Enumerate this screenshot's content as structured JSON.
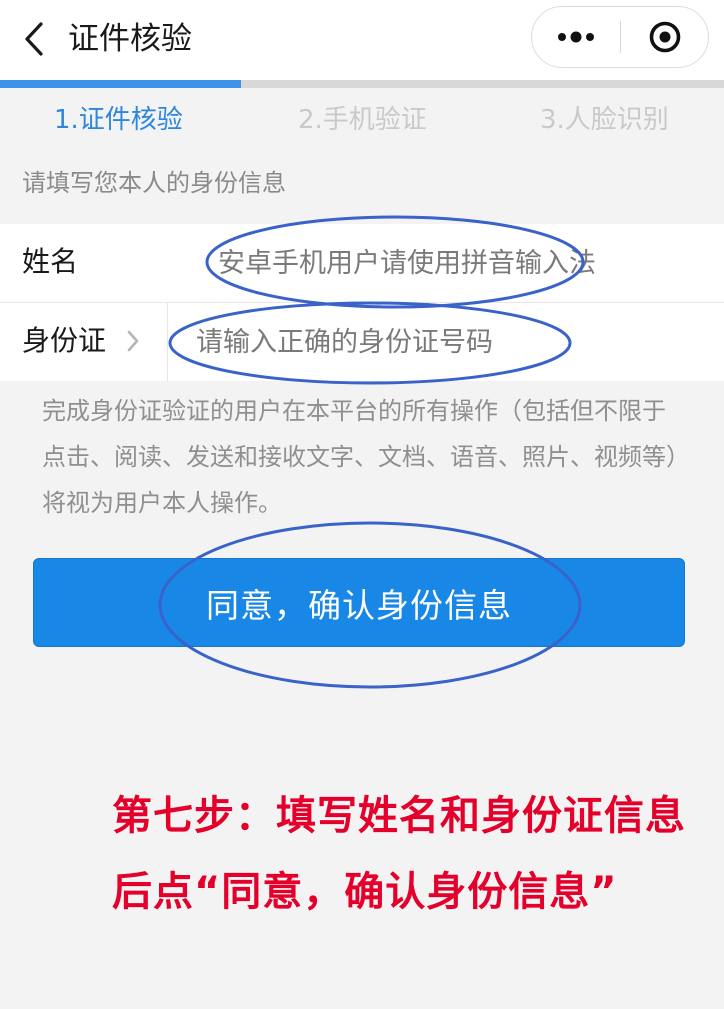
{
  "header": {
    "title": "证件核验",
    "back_icon": "chevron-left-icon",
    "more_icon": "more-dots-icon",
    "close_icon": "target-close-icon"
  },
  "progress": {
    "fraction": 0.333,
    "fill_color": "#3d93e8",
    "track_color": "#d8d8d8"
  },
  "steps": [
    {
      "label": "1.证件核验",
      "state": "active"
    },
    {
      "label": "2.手机验证",
      "state": "inactive"
    },
    {
      "label": "3.人脸识别",
      "state": "inactive"
    }
  ],
  "form": {
    "hint": "请填写您本人的身份信息",
    "name_label": "姓名",
    "name_placeholder": "安卓手机用户请使用拼音输入法",
    "id_label": "身份证",
    "id_placeholder": "请输入正确的身份证号码"
  },
  "disclaimer": "完成身份证验证的用户在本平台的所有操作（包括但不限于点击、阅读、发送和接收文字、文档、语音、照片、视频等）将视为用户本人操作。",
  "confirm_button": {
    "label": "同意，确认身份信息",
    "color": "#1887e6"
  },
  "annotation": {
    "line1": "第七步：填写姓名和身份证信息",
    "line2": "后点“同意，确认身份信息”",
    "text_color": "#e4002b",
    "ellipse_color": "#3a63c9"
  }
}
